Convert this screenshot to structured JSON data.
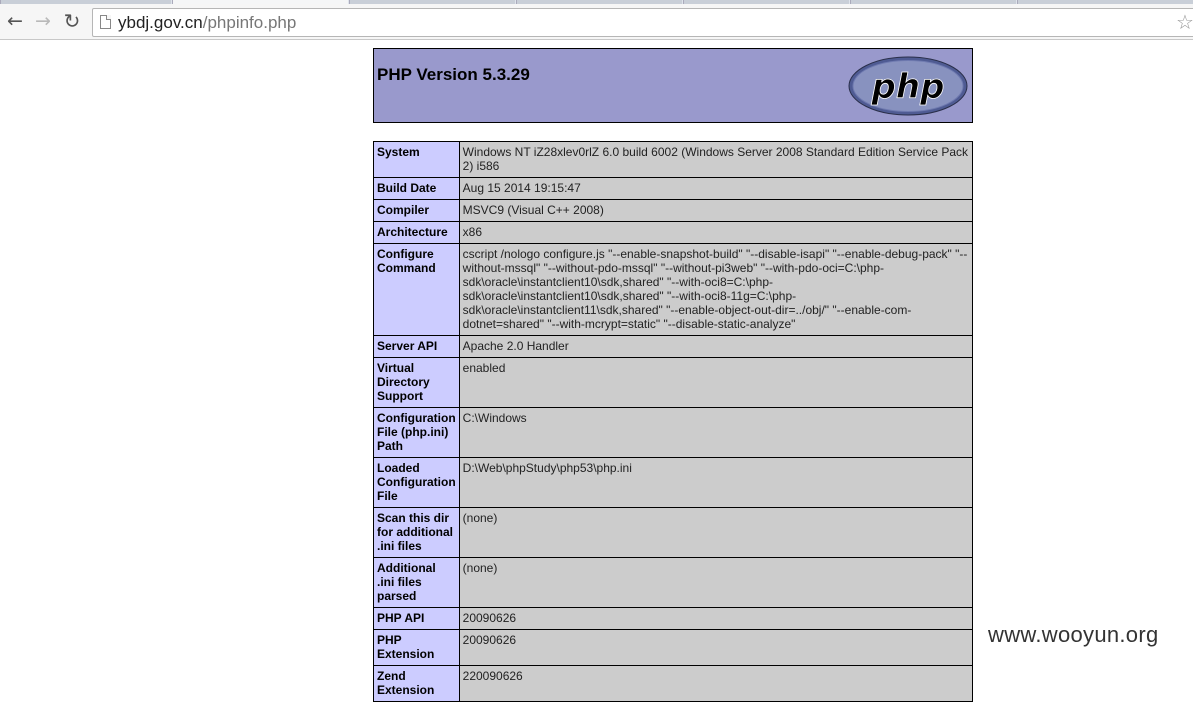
{
  "browser": {
    "url_host": "ybdj.gov.cn",
    "url_path": "/phpinfo.php",
    "back_icon": "back-arrow-icon",
    "forward_icon": "forward-arrow-icon",
    "reload_icon": "reload-icon",
    "bookmark_icon": "star-icon"
  },
  "phpinfo": {
    "title": "PHP Version 5.3.29",
    "logo_text": "php",
    "rows": [
      {
        "key": "System",
        "value": "Windows NT iZ28xlev0rlZ 6.0 build 6002 (Windows Server 2008 Standard Edition Service Pack 2) i586"
      },
      {
        "key": "Build Date",
        "value": "Aug 15 2014 19:15:47"
      },
      {
        "key": "Compiler",
        "value": "MSVC9 (Visual C++ 2008)"
      },
      {
        "key": "Architecture",
        "value": "x86"
      },
      {
        "key": "Configure Command",
        "value": "cscript /nologo configure.js \"--enable-snapshot-build\" \"--disable-isapi\" \"--enable-debug-pack\" \"--without-mssql\" \"--without-pdo-mssql\" \"--without-pi3web\" \"--with-pdo-oci=C:\\php-sdk\\oracle\\instantclient10\\sdk,shared\" \"--with-oci8=C:\\php-sdk\\oracle\\instantclient10\\sdk,shared\" \"--with-oci8-11g=C:\\php-sdk\\oracle\\instantclient11\\sdk,shared\" \"--enable-object-out-dir=../obj/\" \"--enable-com-dotnet=shared\" \"--with-mcrypt=static\" \"--disable-static-analyze\""
      },
      {
        "key": "Server API",
        "value": "Apache 2.0 Handler"
      },
      {
        "key": "Virtual Directory Support",
        "value": "enabled"
      },
      {
        "key": "Configuration File (php.ini) Path",
        "value": "C:\\Windows"
      },
      {
        "key": "Loaded Configuration File",
        "value": "D:\\Web\\phpStudy\\php53\\php.ini"
      },
      {
        "key": "Scan this dir for additional .ini files",
        "value": "(none)"
      },
      {
        "key": "Additional .ini files parsed",
        "value": "(none)"
      },
      {
        "key": "PHP API",
        "value": "20090626"
      },
      {
        "key": "PHP Extension",
        "value": "20090626"
      },
      {
        "key": "Zend Extension",
        "value": "220090626"
      }
    ]
  },
  "watermark": "www.wooyun.org"
}
